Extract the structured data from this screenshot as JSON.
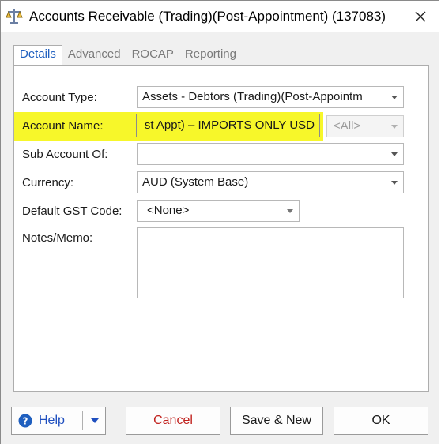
{
  "window": {
    "title": "Accounts Receivable (Trading)(Post-Appointment) (137083)",
    "icon": "scales-icon"
  },
  "tabs": [
    {
      "label": "Details",
      "active": true
    },
    {
      "label": "Advanced",
      "active": false
    },
    {
      "label": "ROCAP",
      "active": false
    },
    {
      "label": "Reporting",
      "active": false
    }
  ],
  "form": {
    "account_type_label": "Account Type:",
    "account_type_value": "Assets - Debtors (Trading)(Post-Appointm",
    "account_name_label": "Account Name:",
    "account_name_value": "st Appt) – IMPORTS ONLY USD",
    "account_name_filter": "<All>",
    "sub_account_label": "Sub Account Of:",
    "sub_account_value": "",
    "currency_label": "Currency:",
    "currency_value": "AUD (System Base)",
    "gst_label": "Default GST Code:",
    "gst_value": "<None>",
    "notes_label": "Notes/Memo:",
    "notes_value": ""
  },
  "buttons": {
    "help_label": "Help",
    "cancel_first": "C",
    "cancel_rest": "ancel",
    "save_new_first": "S",
    "save_new_rest": "ave & New",
    "ok_first": "O",
    "ok_rest": "K"
  },
  "colors": {
    "highlight": "#f7f72a",
    "active_tab": "#1f5fbf",
    "cancel_text": "#c0201c"
  }
}
